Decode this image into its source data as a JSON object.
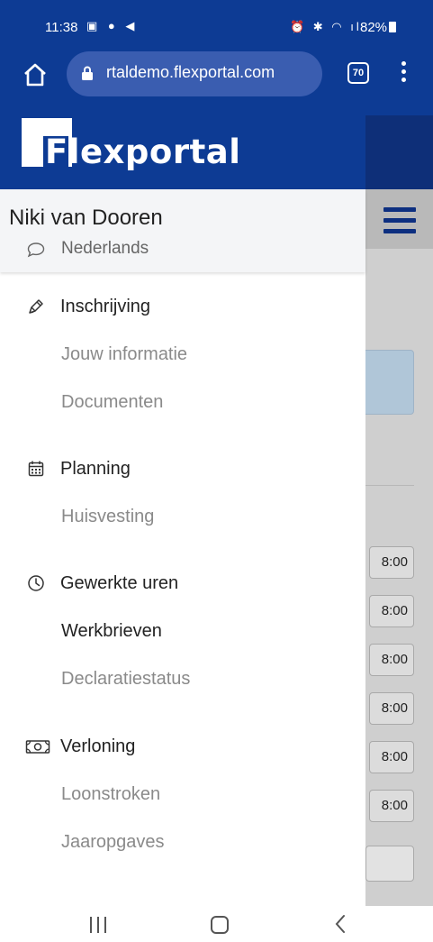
{
  "status_bar": {
    "time": "11:38",
    "battery": "82%"
  },
  "browser": {
    "url": "rtaldemo.flexportal.com",
    "tab_count": "70"
  },
  "brand": {
    "logo_text": "lexport",
    "logo_letter": "F",
    "logo_suffix": "al",
    "primary_color": "#0d3b94"
  },
  "user": {
    "name": "Niki van Dooren",
    "language": "Nederlands"
  },
  "menu": {
    "sections": [
      {
        "title": "Inschrijving",
        "icon": "pen-icon",
        "items": [
          "Jouw informatie",
          "Documenten"
        ]
      },
      {
        "title": "Planning",
        "icon": "calendar-icon",
        "items": [
          "Huisvesting"
        ]
      },
      {
        "title": "Gewerkte uren",
        "icon": "clock-icon",
        "items": [
          "Werkbrieven",
          "Declaratiestatus"
        ],
        "active_item": "Werkbrieven"
      },
      {
        "title": "Verloning",
        "icon": "money-icon",
        "items": [
          "Loonstroken",
          "Jaaropgaves"
        ]
      }
    ]
  },
  "background_page": {
    "times": [
      "8:00",
      "8:00",
      "8:00",
      "8:00",
      "8:00",
      "8:00"
    ]
  }
}
